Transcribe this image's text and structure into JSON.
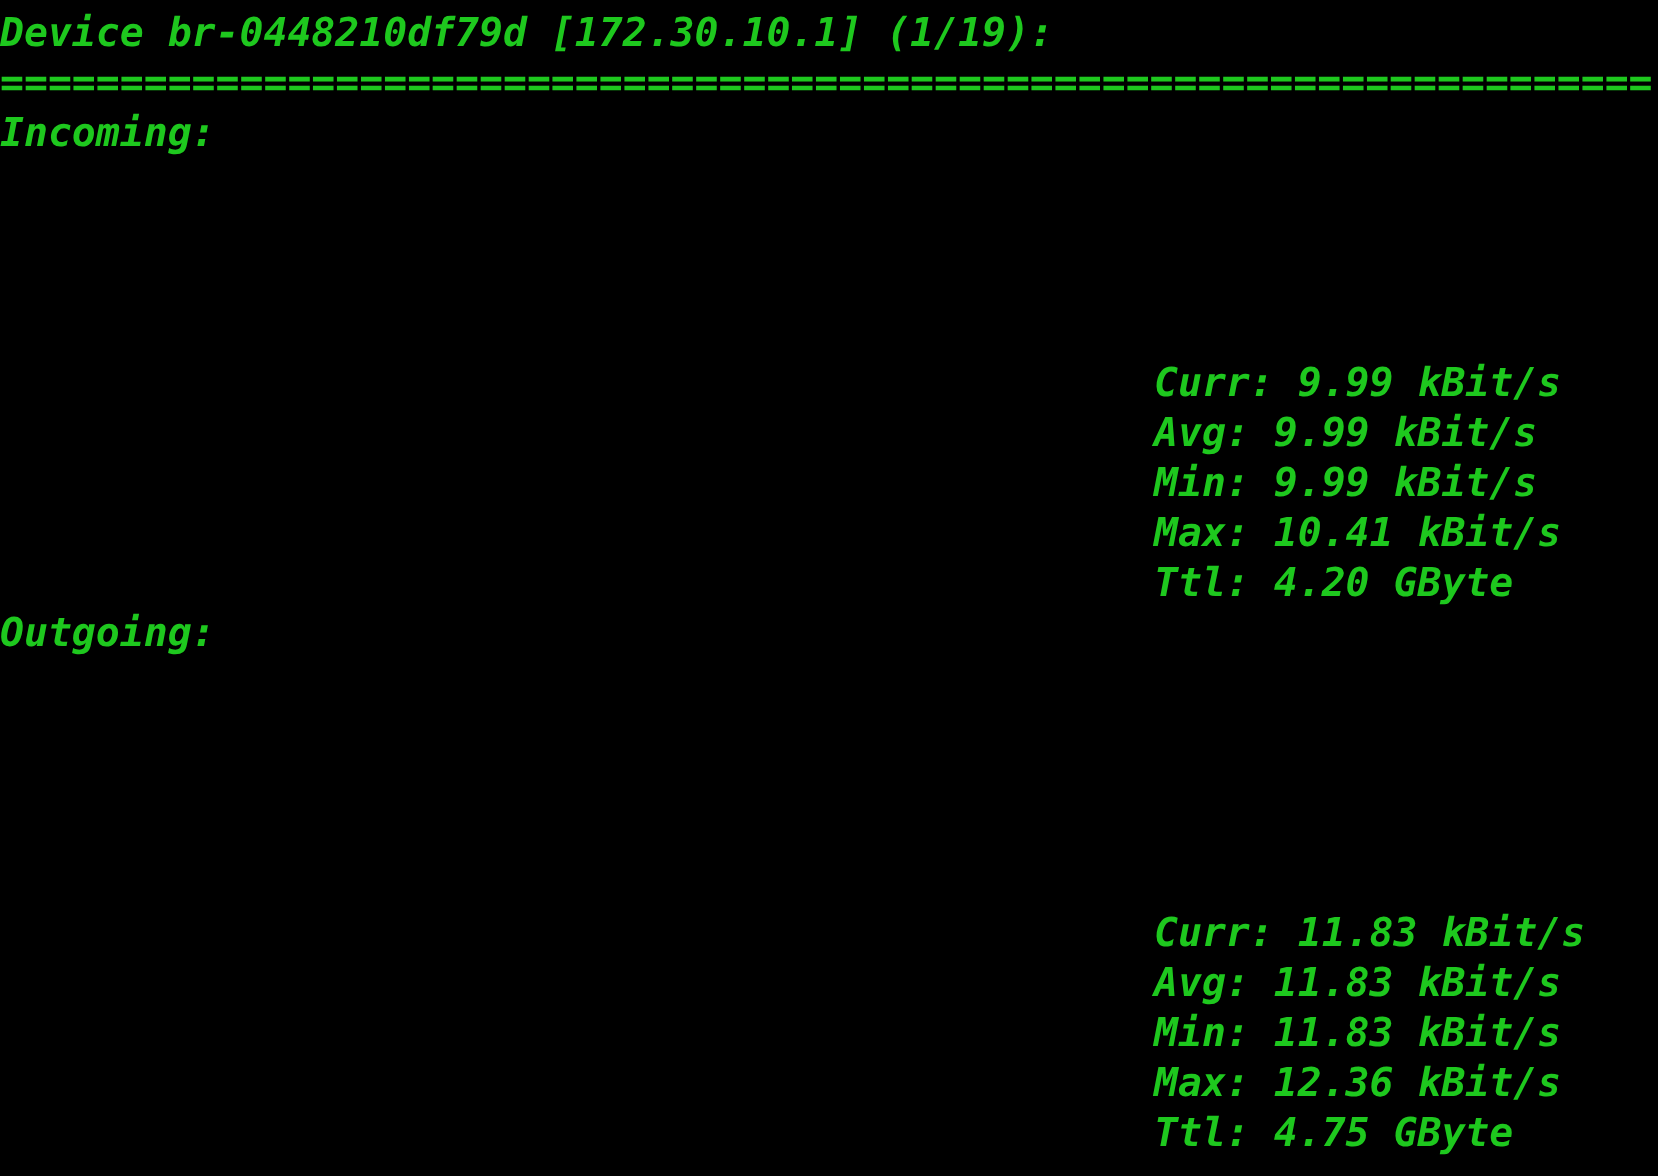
{
  "header": {
    "title": "Device br-0448210df79d [172.30.10.1] (1/19):",
    "separator": "====================================================================="
  },
  "sections": [
    {
      "label": "Incoming:",
      "stats": [
        "Curr: 9.99 kBit/s",
        "Avg: 9.99 kBit/s",
        "Min: 9.99 kBit/s",
        "Max: 10.41 kBit/s",
        "Ttl: 4.20 GByte"
      ]
    },
    {
      "label": "Outgoing:",
      "stats": [
        "Curr: 11.83 kBit/s",
        "Avg: 11.83 kBit/s",
        "Min: 11.83 kBit/s",
        "Max: 12.36 kBit/s",
        "Ttl: 4.75 GByte"
      ]
    }
  ]
}
